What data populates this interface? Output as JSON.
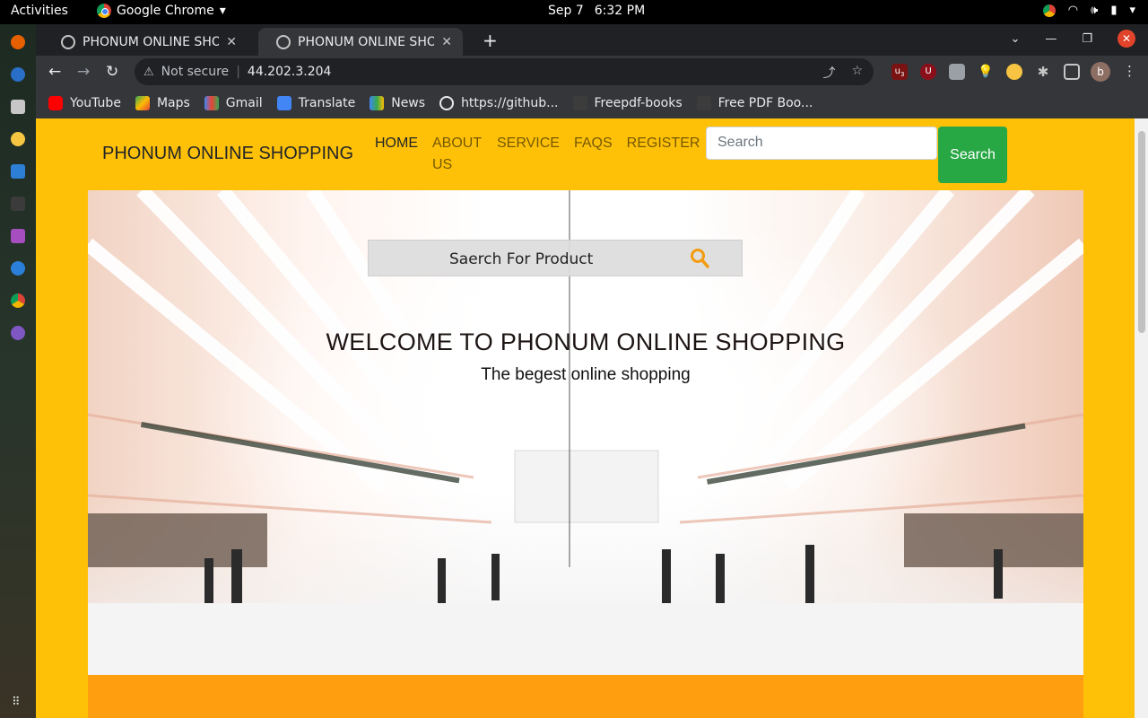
{
  "system": {
    "activities": "Activities",
    "app_name": "Google Chrome",
    "date": "Sep 7",
    "time": "6:32 PM"
  },
  "browser": {
    "tabs": [
      {
        "title": "PHONUM ONLINE SHOPPING",
        "active": false
      },
      {
        "title": "PHONUM ONLINE SHOPPING",
        "active": true
      }
    ],
    "security": "Not secure",
    "url": "44.202.3.204",
    "ext_badge": "3",
    "profile_initial": "b",
    "bookmarks": [
      {
        "label": "YouTube",
        "icon": "youtube-icon",
        "color": "#ff0000"
      },
      {
        "label": "Maps",
        "icon": "maps-icon",
        "color": "#34a853"
      },
      {
        "label": "Gmail",
        "icon": "gmail-icon",
        "color": "#ea4335"
      },
      {
        "label": "Translate",
        "icon": "translate-icon",
        "color": "#4285f4"
      },
      {
        "label": "News",
        "icon": "news-icon",
        "color": "#4285f4"
      },
      {
        "label": "https://github...",
        "icon": "github-icon",
        "color": "#ffffff"
      },
      {
        "label": "Freepdf-books",
        "icon": "page-icon",
        "color": "#3c3c3c"
      },
      {
        "label": "Free PDF Boo...",
        "icon": "page-icon",
        "color": "#3c3c3c"
      }
    ]
  },
  "site": {
    "brand": "PHONUM ONLINE SHOPPING",
    "nav": [
      "HOME",
      "ABOUT US",
      "SERVICE",
      "FAQS",
      "REGISTER"
    ],
    "search_placeholder": "Search",
    "search_button": "Search",
    "hero": {
      "search_label": "Saerch For Product",
      "welcome": "WELCOME TO PHONUM ONLINE SHOPPING",
      "subtitle": "The begest online shopping"
    },
    "colors": {
      "page_bg": "#ffc107",
      "search_btn": "#28a745",
      "footer_band": "#ff9e0e",
      "magnifier": "#f39c12"
    }
  }
}
